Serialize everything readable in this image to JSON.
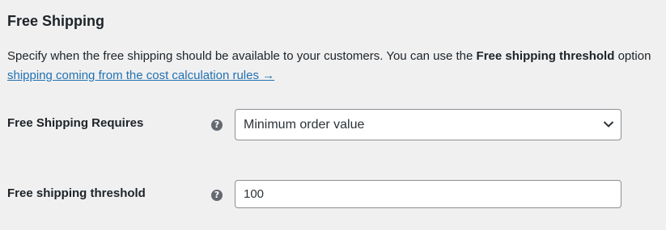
{
  "section": {
    "title": "Free Shipping"
  },
  "description": {
    "text_before": "Specify when the free shipping should be available to your customers. You can use the ",
    "bold": "Free shipping threshold",
    "text_after": " option",
    "link": "shipping coming from the cost calculation rules →"
  },
  "requires": {
    "label": "Free Shipping Requires",
    "help_icon": "question-circle-icon",
    "selected": "Minimum order value"
  },
  "threshold": {
    "label": "Free shipping threshold",
    "help_icon": "question-circle-icon",
    "value": "100"
  },
  "colors": {
    "background": "#f0f0f1",
    "link": "#2271b1",
    "text": "#1d2327",
    "icon": "#646970"
  }
}
